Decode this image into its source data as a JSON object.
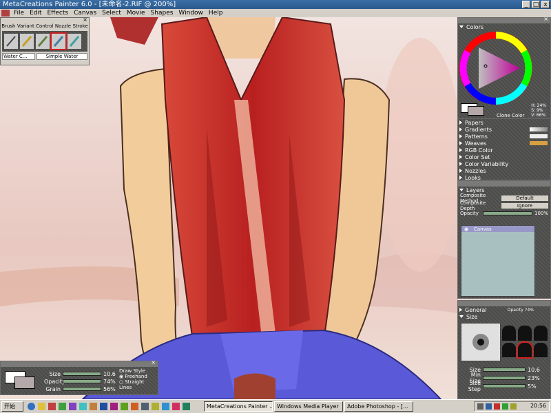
{
  "window": {
    "title": "MetaCreations Painter 6.0 - [未命名-2.RIF @ 200%]",
    "min": "_",
    "max": "□",
    "close": "x"
  },
  "menu": [
    "File",
    "Edit",
    "Effects",
    "Canvas",
    "Select",
    "Movie",
    "Shapes",
    "Window",
    "Help"
  ],
  "brush_panel": {
    "tabs": [
      "Brush",
      "Variant",
      "Control",
      "Nozzle",
      "Stroke"
    ],
    "category": "Water C...",
    "variant": "Simple Water"
  },
  "colors_panel": {
    "title": "Colors",
    "hsv": {
      "h": "H: 24%",
      "s": "S: 9%",
      "v": "V: 66%"
    },
    "clone_label": "Clone Color",
    "colors": {
      "bg": "#b4a8a8",
      "accent": "#ff00aa"
    }
  },
  "palette_items": [
    "Papers",
    "Gradients",
    "Patterns",
    "Weaves",
    "RGB Color",
    "Color Set",
    "Color Variability",
    "Nozzles",
    "Looks"
  ],
  "layers_panel": {
    "title": "Layers",
    "composite_method_label": "Composite Method",
    "composite_method_value": "Default",
    "composite_depth_label": "Composite Depth",
    "composite_depth_value": "Ignore",
    "opacity_label": "Opacity",
    "opacity_value": "100%",
    "layer_name": "Canvas"
  },
  "brush_controls": {
    "general_label": "General",
    "general_opacity": "Opacity 74%",
    "size_label": "Size",
    "size_value": "10.6",
    "min_size_label": "Min Size",
    "min_size_value": "23%",
    "size_step_label": "Size Step",
    "size_step_value": "5%"
  },
  "controls_panel": {
    "size_label": "Size",
    "size_value": "10.6",
    "opacity_label": "Opacity",
    "opacity_value": "74%",
    "grain_label": "Grain",
    "grain_value": "56%",
    "draw_style_label": "Draw Style",
    "freehand": "Freehand",
    "straight": "Straight Lines"
  },
  "taskbar": {
    "start": "开始",
    "tasks": [
      "MetaCreations Painter ...",
      "Windows Media Player",
      "Adobe Photoshop - [..."
    ],
    "time": "20:56"
  }
}
